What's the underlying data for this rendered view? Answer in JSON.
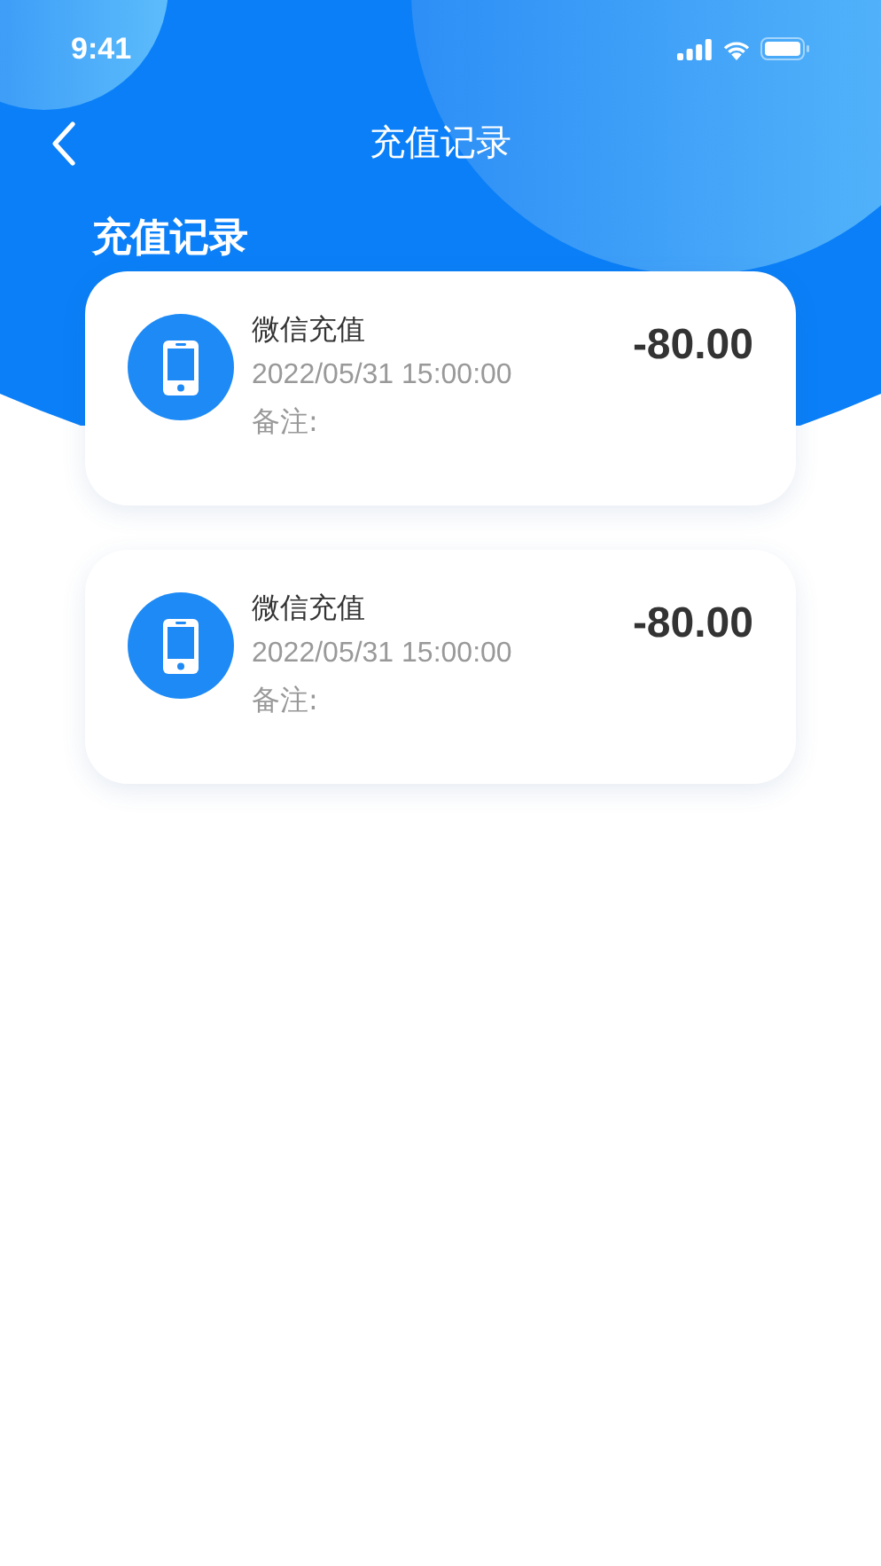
{
  "status_bar": {
    "time": "9:41"
  },
  "nav": {
    "title": "充值记录"
  },
  "section_title": "充值记录",
  "records": [
    {
      "title": "微信充值",
      "time": "2022/05/31  15:00:00",
      "note": "备注:",
      "amount": "-80.00"
    },
    {
      "title": "微信充值",
      "time": "2022/05/31  15:00:00",
      "note": "备注:",
      "amount": "-80.00"
    }
  ]
}
